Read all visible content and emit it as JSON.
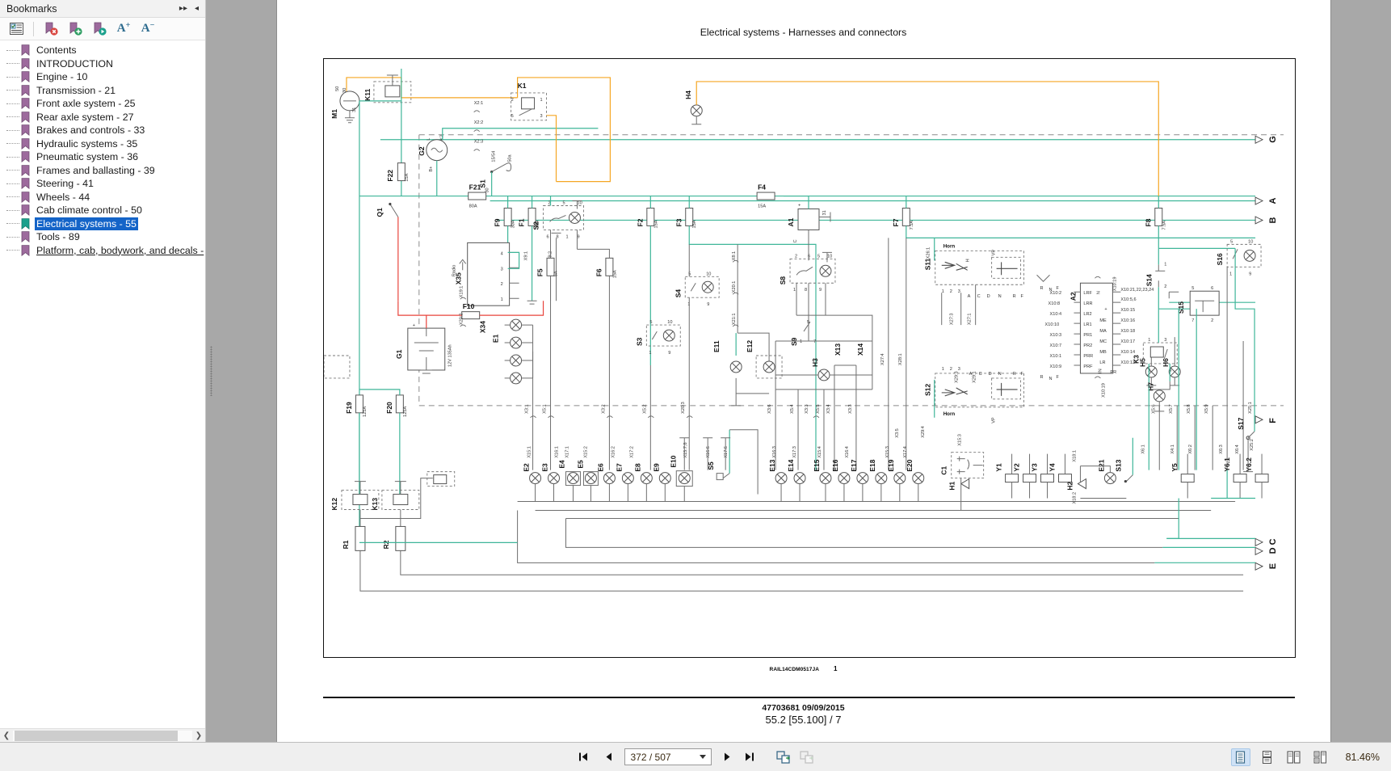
{
  "bookmarks_panel": {
    "title": "Bookmarks",
    "header_buttons": [
      {
        "name": "expand-all-arrow",
        "glyph": "▸▸"
      },
      {
        "name": "collapse-panel-arrow",
        "glyph": "◂"
      }
    ],
    "toolbar": [
      {
        "name": "toggle-bookmark-list",
        "label": ""
      },
      {
        "name": "delete-bookmark",
        "label": ""
      },
      {
        "name": "add-bookmark",
        "label": ""
      },
      {
        "name": "goto-bookmark",
        "label": ""
      },
      {
        "name": "increase-font-size",
        "label": "A",
        "sup": "+"
      },
      {
        "name": "decrease-font-size",
        "label": "A",
        "sup": "−"
      }
    ],
    "items": [
      {
        "label": "Contents",
        "state": "normal"
      },
      {
        "label": "INTRODUCTION",
        "state": "normal"
      },
      {
        "label": "Engine - 10",
        "state": "normal"
      },
      {
        "label": "Transmission - 21",
        "state": "normal"
      },
      {
        "label": "Front axle system - 25",
        "state": "normal"
      },
      {
        "label": "Rear axle system - 27",
        "state": "normal"
      },
      {
        "label": "Brakes and controls - 33",
        "state": "normal"
      },
      {
        "label": "Hydraulic systems - 35",
        "state": "normal"
      },
      {
        "label": "Pneumatic system - 36",
        "state": "normal"
      },
      {
        "label": "Frames and ballasting - 39",
        "state": "normal"
      },
      {
        "label": "Steering - 41",
        "state": "normal"
      },
      {
        "label": "Wheels - 44",
        "state": "normal"
      },
      {
        "label": "Cab climate control - 50",
        "state": "normal"
      },
      {
        "label": "Electrical systems - 55",
        "state": "selected"
      },
      {
        "label": "Tools - 89",
        "state": "normal"
      },
      {
        "label": "Platform, cab, bodywork, and decals -",
        "state": "hovered"
      }
    ],
    "selected_color": "#1464c8",
    "flag_color": "#9d6a9d",
    "selected_flag_color": "#1aa08c"
  },
  "document": {
    "header_title": "Electrical systems - Harnesses and connectors",
    "figure_caption_code": "RAIL14CDM0517JA",
    "figure_caption_number": "1",
    "footer_line1": "47703681 09/09/2015",
    "footer_line2": "55.2 [55.100] / 7"
  },
  "statusbar": {
    "first_page_icon": "first-page",
    "prev_page_icon": "previous-page",
    "page_value": "372 / 507",
    "next_page_icon": "next-page",
    "last_page_icon": "last-page",
    "fit_page_icon": "fit-page",
    "fit_width_icon": "fit-width",
    "view_modes": [
      {
        "name": "single-page-view",
        "active": true
      },
      {
        "name": "continuous-page-view",
        "active": false
      },
      {
        "name": "two-page-view",
        "active": false
      },
      {
        "name": "two-page-continuous-view",
        "active": false
      }
    ],
    "zoom_level": "81.46%"
  },
  "schematic": {
    "colors": {
      "wire_green": "#3fb699",
      "wire_orange": "#f5a623",
      "wire_red": "#e8433b",
      "wire_gray": "#6e6e6e",
      "wire_black": "#1a1a1a",
      "dashed": "#7a7a7a"
    },
    "edge_markers": [
      "G",
      "A",
      "B",
      "F",
      "C",
      "D",
      "E"
    ],
    "components": [
      {
        "ref": "M1",
        "type": "starter-motor",
        "pins": [
          "50",
          "30",
          "31"
        ]
      },
      {
        "ref": "K11",
        "type": "relay"
      },
      {
        "ref": "K1",
        "type": "relay",
        "pins": [
          "2",
          "1",
          "5",
          "3"
        ]
      },
      {
        "ref": "G2",
        "type": "alternator",
        "pins": [
          "B+",
          "L",
          "K2"
        ]
      },
      {
        "ref": "G1",
        "type": "battery",
        "rating": "12V 135Ah"
      },
      {
        "ref": "H4",
        "type": "lamp"
      },
      {
        "ref": "F22",
        "rating": "15A",
        "type": "fuse"
      },
      {
        "ref": "F21",
        "rating": "80A",
        "type": "fuse"
      },
      {
        "ref": "F9",
        "rating": "30A",
        "type": "fuse"
      },
      {
        "ref": "F10",
        "type": "fuse"
      },
      {
        "ref": "F1",
        "rating": "15A",
        "type": "fuse"
      },
      {
        "ref": "F2",
        "rating": "15A",
        "type": "fuse"
      },
      {
        "ref": "F3",
        "rating": "15A",
        "type": "fuse"
      },
      {
        "ref": "F4",
        "rating": "15A",
        "type": "fuse"
      },
      {
        "ref": "F5",
        "rating": "5A",
        "type": "fuse"
      },
      {
        "ref": "F6",
        "rating": "15A",
        "type": "fuse"
      },
      {
        "ref": "F7",
        "rating": "7.5A",
        "type": "fuse"
      },
      {
        "ref": "F8",
        "rating": "7.5A",
        "type": "fuse"
      },
      {
        "ref": "F19",
        "rating": "125A",
        "type": "fuse"
      },
      {
        "ref": "F20",
        "rating": "125A",
        "type": "fuse"
      },
      {
        "ref": "Q1",
        "type": "battery-switch"
      },
      {
        "ref": "S1",
        "type": "key-switch",
        "pins": [
          "15/54",
          "50a",
          "30"
        ]
      },
      {
        "ref": "X35",
        "type": "connector",
        "pins": [
          "4",
          "3",
          "2",
          "1"
        ]
      },
      {
        "ref": "X34",
        "type": "connector"
      },
      {
        "ref": "S2",
        "type": "switch-lamp",
        "pins": [
          "2",
          "5",
          "10",
          "6",
          "8",
          "1",
          "9"
        ]
      },
      {
        "ref": "S3",
        "type": "switch-lamp",
        "pins": [
          "5",
          "10",
          "1",
          "9"
        ]
      },
      {
        "ref": "S4",
        "type": "switch-lamp",
        "pins": [
          "5",
          "10",
          "1",
          "9"
        ]
      },
      {
        "ref": "S5",
        "type": "switch"
      },
      {
        "ref": "S8",
        "type": "switch-lamp",
        "pins": [
          "2",
          "6",
          "5",
          "10",
          "1",
          "8",
          "9"
        ]
      },
      {
        "ref": "S9",
        "type": "switch",
        "pins": [
          "5",
          "1",
          "7"
        ]
      },
      {
        "ref": "S11",
        "type": "multifunction-stalk",
        "label": "Horn",
        "pins": [
          "1",
          "2",
          "3",
          "A",
          "C",
          "D",
          "N",
          "R",
          "F",
          "H",
          "VP"
        ]
      },
      {
        "ref": "S12",
        "type": "multifunction-stalk",
        "label": "Horn",
        "pins": [
          "1",
          "2",
          "3",
          "A",
          "C",
          "D",
          "N",
          "R",
          "F",
          "H",
          "VP"
        ]
      },
      {
        "ref": "S13",
        "type": "switch"
      },
      {
        "ref": "S14",
        "type": "switch",
        "pins": [
          "1",
          "2"
        ]
      },
      {
        "ref": "S15",
        "type": "switch",
        "pins": [
          "5",
          "6",
          "7",
          "2"
        ]
      },
      {
        "ref": "S16",
        "type": "switch-lamp",
        "pins": [
          "5",
          "10",
          "1",
          "9"
        ]
      },
      {
        "ref": "S17",
        "type": "switch"
      },
      {
        "ref": "A1",
        "type": "module",
        "pins": [
          "+",
          "31",
          "C"
        ]
      },
      {
        "ref": "A2",
        "type": "control-module",
        "left_pins": [
          "LRF",
          "LRR",
          "LR2",
          "LR1",
          "PR1",
          "PR2",
          "PRR",
          "PRF"
        ],
        "right_pins": [
          "N",
          "+",
          "ME",
          "MA",
          "MC",
          "MB",
          "LR",
          "PR",
          "IN"
        ],
        "left_refs": [
          "X10:2",
          "X10:8",
          "X10:4",
          "X10:10",
          "X10:3",
          "X10:7",
          "X10:1",
          "X10:9"
        ],
        "right_refs": [
          "X10:21,22,23,24",
          "X10:5,6",
          "X10:15",
          "X10:16",
          "X10:18",
          "X10:17",
          "X10:14",
          "X10:13"
        ],
        "top_ref": "X10:19",
        "bottom_ref": "X10:19"
      },
      {
        "ref": "K3",
        "type": "relay",
        "pins": [
          "1",
          "3",
          "2",
          "4"
        ]
      },
      {
        "ref": "K12",
        "type": "relay"
      },
      {
        "ref": "K13",
        "type": "relay"
      },
      {
        "ref": "R1",
        "type": "resistor"
      },
      {
        "ref": "R2",
        "type": "resistor"
      },
      {
        "ref": "C1",
        "type": "flasher-unit"
      },
      {
        "ref": "H1",
        "type": "horn"
      },
      {
        "ref": "H2",
        "type": "horn"
      },
      {
        "ref": "H3",
        "type": "lamp"
      },
      {
        "ref": "H5",
        "type": "lamp"
      },
      {
        "ref": "H6",
        "type": "lamp"
      },
      {
        "ref": "H7",
        "type": "lamp"
      },
      {
        "ref": "E1",
        "type": "lamp-cluster"
      },
      {
        "ref": "E2",
        "type": "lamp"
      },
      {
        "ref": "E3",
        "type": "lamp"
      },
      {
        "ref": "E4",
        "type": "lamp"
      },
      {
        "ref": "E5",
        "type": "lamp"
      },
      {
        "ref": "E6",
        "type": "lamp"
      },
      {
        "ref": "E7",
        "type": "lamp"
      },
      {
        "ref": "E8",
        "type": "lamp"
      },
      {
        "ref": "E9",
        "type": "lamp"
      },
      {
        "ref": "E10",
        "type": "lamp"
      },
      {
        "ref": "E11",
        "type": "lamp"
      },
      {
        "ref": "E12",
        "type": "lamp"
      },
      {
        "ref": "E13",
        "type": "lamp"
      },
      {
        "ref": "E14",
        "type": "lamp"
      },
      {
        "ref": "E15",
        "type": "lamp"
      },
      {
        "ref": "E16",
        "type": "lamp"
      },
      {
        "ref": "E17",
        "type": "lamp"
      },
      {
        "ref": "E18",
        "type": "lamp"
      },
      {
        "ref": "E19",
        "type": "lamp"
      },
      {
        "ref": "E20",
        "type": "lamp"
      },
      {
        "ref": "E21",
        "type": "lamp"
      },
      {
        "ref": "Y1",
        "type": "solenoid"
      },
      {
        "ref": "Y2",
        "type": "solenoid"
      },
      {
        "ref": "Y3",
        "type": "solenoid"
      },
      {
        "ref": "Y4",
        "type": "solenoid"
      },
      {
        "ref": "Y5",
        "type": "solenoid"
      },
      {
        "ref": "Y6.1",
        "type": "solenoid"
      },
      {
        "ref": "Y6.2",
        "type": "solenoid"
      }
    ],
    "connector_labels": [
      "X2:1",
      "X2:2",
      "X2:3",
      "X9:1",
      "X9:2",
      "X19:1",
      "X20:2",
      "X23:4",
      "X24",
      "X3:1",
      "X3:2",
      "X3:3",
      "X3:4",
      "X5:1",
      "X5:2",
      "X5:3",
      "X20:3",
      "X8:1",
      "X20:1",
      "X21:1",
      "X8:2",
      "X13",
      "X14",
      "X15:1",
      "X16:1",
      "X17:1",
      "X15:2",
      "X16:2",
      "X17:2",
      "X15:7,8",
      "X16:6",
      "X17:6",
      "X16:3",
      "X17:3",
      "X15:4",
      "X16:4",
      "X15:5",
      "X17:4",
      "X15:3",
      "X26:1",
      "X26:2",
      "X26:3",
      "X26:4",
      "X27:1",
      "X27:3",
      "X27:4",
      "X28:1",
      "X28:2",
      "X29:1",
      "X29:3",
      "X29:4",
      "X3:5",
      "X5:6",
      "X5:7",
      "X5:8",
      "X5:9",
      "X5:10",
      "X6:1",
      "X6:2",
      "X6:3",
      "X6:4",
      "X4:1",
      "X10:5,6",
      "X10:15",
      "X10:16",
      "X10:17",
      "X10:18",
      "X10:13",
      "X10:14",
      "X22:4",
      "X23:1",
      "X25:1",
      "X25:2",
      "X18:1",
      "X18:2",
      "X19:2",
      "Radio"
    ]
  }
}
